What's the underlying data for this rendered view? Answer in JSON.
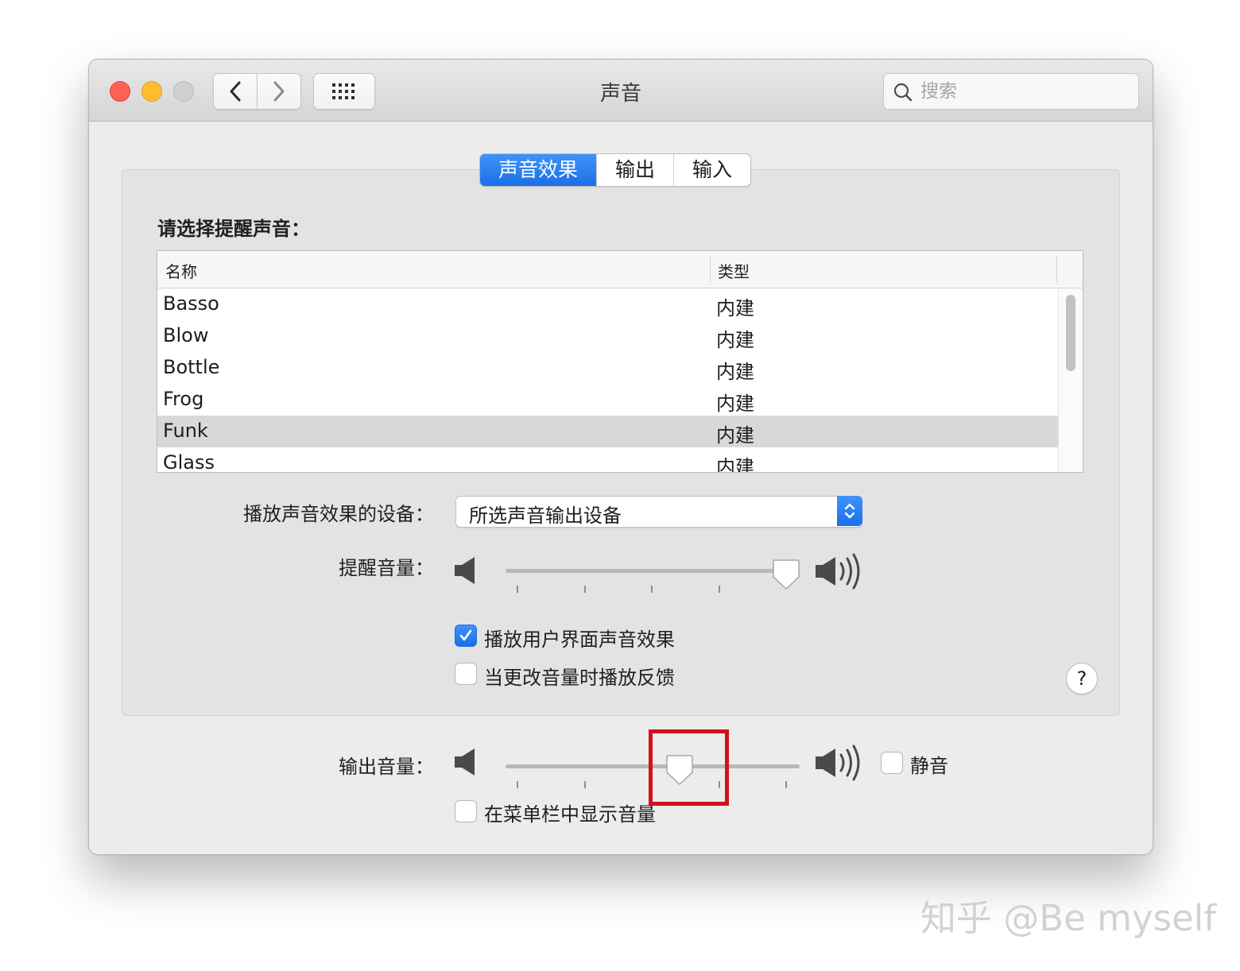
{
  "window": {
    "title": "声音",
    "search_placeholder": "搜索"
  },
  "tabs": [
    {
      "label": "声音效果",
      "active": true
    },
    {
      "label": "输出",
      "active": false
    },
    {
      "label": "输入",
      "active": false
    }
  ],
  "sound_effects": {
    "section_label": "请选择提醒声音：",
    "table": {
      "columns": [
        "名称",
        "类型"
      ],
      "rows": [
        {
          "name": "Basso",
          "type": "内建",
          "selected": false
        },
        {
          "name": "Blow",
          "type": "内建",
          "selected": false
        },
        {
          "name": "Bottle",
          "type": "内建",
          "selected": false
        },
        {
          "name": "Frog",
          "type": "内建",
          "selected": false
        },
        {
          "name": "Funk",
          "type": "内建",
          "selected": true
        },
        {
          "name": "Glass",
          "type": "内建",
          "selected": false
        }
      ]
    },
    "device_label": "播放声音效果的设备：",
    "device_value": "所选声音输出设备",
    "alert_volume_label": "提醒音量：",
    "alert_volume_level": 1.0,
    "checkbox_ui_sounds": {
      "label": "播放用户界面声音效果",
      "checked": true
    },
    "checkbox_feedback": {
      "label": "当更改音量时播放反馈",
      "checked": false
    },
    "help_label": "?"
  },
  "output": {
    "volume_label": "输出音量：",
    "volume_level": 0.6,
    "mute": {
      "label": "静音",
      "checked": false
    },
    "menubar": {
      "label": "在菜单栏中显示音量",
      "checked": false
    }
  },
  "colors": {
    "accent": "#1b6fe8",
    "highlight_box": "#d0121b"
  },
  "watermark": "知乎 @Be myself"
}
